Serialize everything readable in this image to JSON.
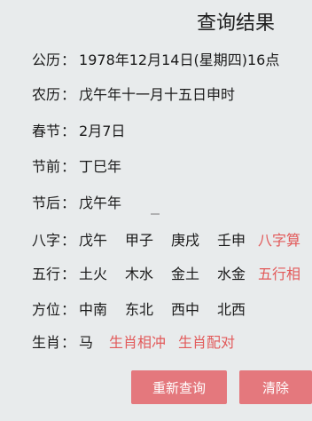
{
  "title": "查询结果",
  "rows": {
    "gongli": {
      "label": "公历",
      "value": "1978年12月14日(星期四)16点"
    },
    "nongli": {
      "label": "农历",
      "value": "戊午年十一月十五日申时"
    },
    "chunjie": {
      "label": "春节",
      "value": "2月7日"
    },
    "jieqian": {
      "label": "节前",
      "value": "丁巳年"
    },
    "jiehou": {
      "label": "节后",
      "value": "戊午年"
    }
  },
  "bazi": {
    "label": "八字",
    "cells": [
      "戊午",
      "甲子",
      "庚戌",
      "壬申"
    ],
    "link": "八字算"
  },
  "wuxing": {
    "label": "五行",
    "cells": [
      "土火",
      "木水",
      "金土",
      "水金"
    ],
    "link": "五行相"
  },
  "fangwei": {
    "label": "方位",
    "cells": [
      "中南",
      "东北",
      "西中",
      "北西"
    ]
  },
  "shengxiao": {
    "label": "生肖",
    "value": "马",
    "links": [
      "生肖相冲",
      "生肖配对"
    ]
  },
  "buttons": {
    "requery": "重新查询",
    "clear": "清除"
  },
  "colors": {
    "accent": "#e25a5a",
    "button": "#e4787d",
    "background": "#e8ebec"
  }
}
